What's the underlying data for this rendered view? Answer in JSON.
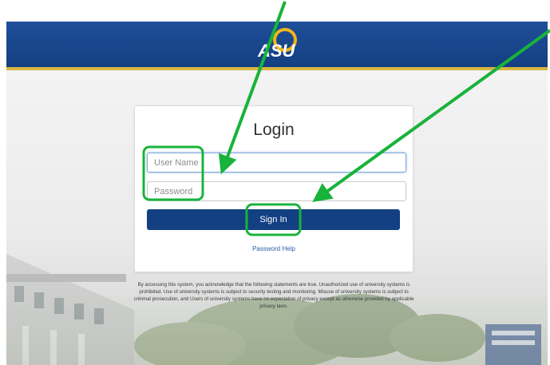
{
  "header": {
    "logo_text": "ASU",
    "brand_colors": {
      "band": "#1b4a90",
      "stripe": "#d9b640",
      "gold": "#f2b51c"
    }
  },
  "login": {
    "title": "Login",
    "username_placeholder": "User Name",
    "password_placeholder": "Password",
    "signin_label": "Sign In",
    "help_link": "Password Help"
  },
  "disclaimer": "By accessing this system, you acknowledge that the following statements are true. Unauthorized use of university systems is prohibited. Use of university systems is subject to security testing and monitoring. Misuse of university systems is subject to criminal prosecution, and Users of university systems have no expectation of privacy except as otherwise provided by applicable privacy laws.",
  "annotations": {
    "color": "#18b33b",
    "highlights": [
      "username-and-password-fields",
      "sign-in-button"
    ],
    "arrows": [
      "arrow-to-username-field",
      "arrow-to-sign-in-button"
    ]
  }
}
